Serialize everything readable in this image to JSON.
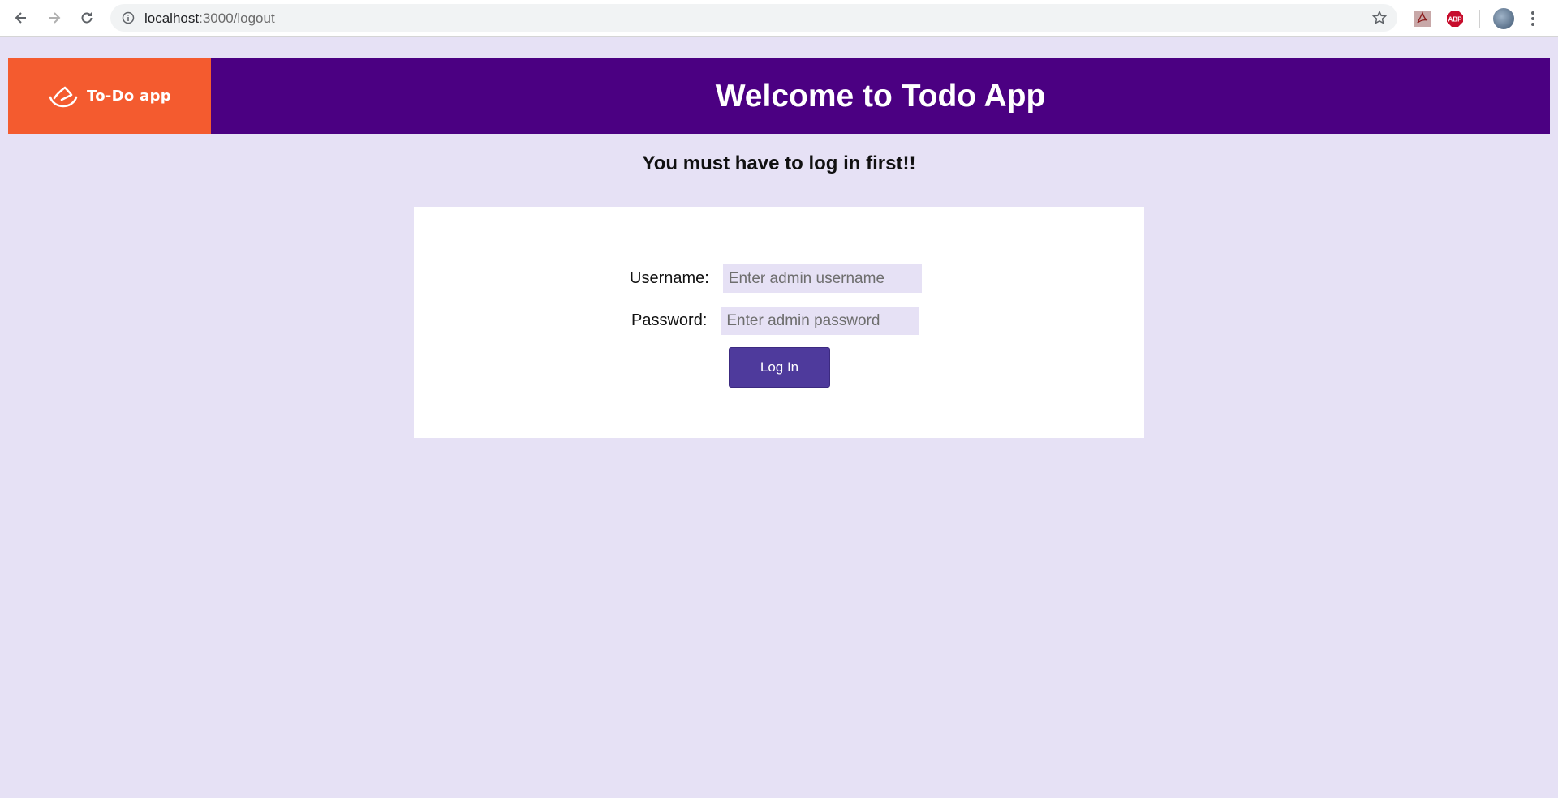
{
  "browser": {
    "url_host": "localhost",
    "url_path": ":3000/logout"
  },
  "header": {
    "logo_text": "To-Do app",
    "title": "Welcome to Todo App"
  },
  "notice": "You must have to log in first!!",
  "login_form": {
    "username_label": "Username:",
    "username_placeholder": "Enter admin username",
    "password_label": "Password:",
    "password_placeholder": "Enter admin password",
    "submit_label": "Log In"
  },
  "colors": {
    "page_bg": "#e6e1f5",
    "header_bg": "#4b0082",
    "logo_bg": "#f45b2f",
    "button_bg": "#4e3a9c"
  }
}
